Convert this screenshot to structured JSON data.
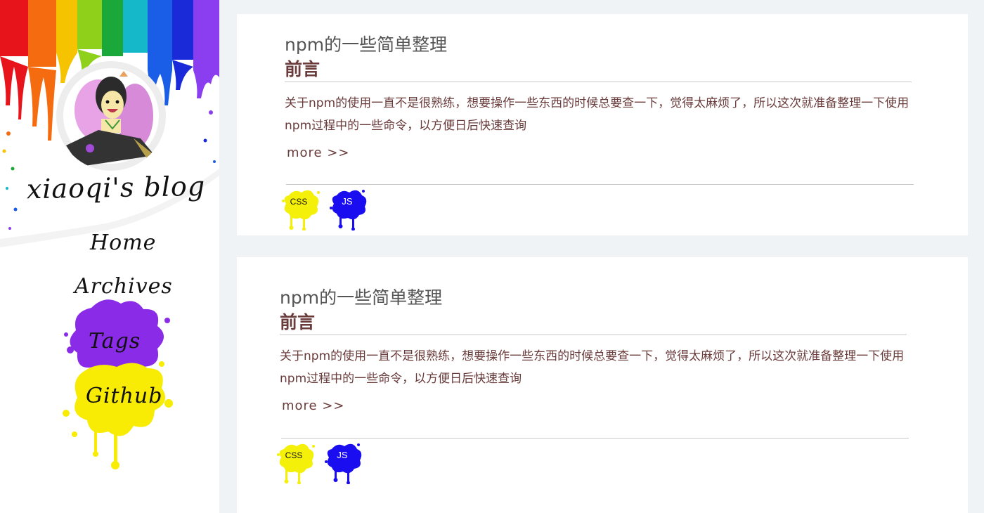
{
  "sidebar": {
    "blog_title": "xiaoqi's blog",
    "nav": [
      {
        "label": "Home"
      },
      {
        "label": "Archives"
      },
      {
        "label": "Tags"
      },
      {
        "label": "Github"
      }
    ]
  },
  "posts": [
    {
      "title": "npm的一些简单整理",
      "subtitle": "前言",
      "excerpt": "关于npm的使用一直不是很熟练，想要操作一些东西的时候总要查一下，觉得太麻烦了，所以这次就准备整理一下使用npm过程中的一些命令，以方便日后快速查询",
      "more_label": "more  >>",
      "tags": [
        {
          "label": "CSS",
          "color": "#f5f00a"
        },
        {
          "label": "JS",
          "color": "#1a0ef0"
        }
      ]
    },
    {
      "title": "npm的一些简单整理",
      "subtitle": "前言",
      "excerpt": "关于npm的使用一直不是很熟练，想要操作一些东西的时候总要查一下，觉得太麻烦了，所以这次就准备整理一下使用npm过程中的一些命令，以方便日后快速查询",
      "more_label": "more  >>",
      "tags": [
        {
          "label": "CSS",
          "color": "#f5f00a"
        },
        {
          "label": "JS",
          "color": "#1a0ef0"
        }
      ]
    }
  ],
  "colors": {
    "accent_text": "#6a3b3b",
    "title_text": "#555555",
    "page_bg": "#eff3f6",
    "nav_splash_purple": "#8a2be8",
    "nav_splash_yellow": "#f8ec05"
  }
}
